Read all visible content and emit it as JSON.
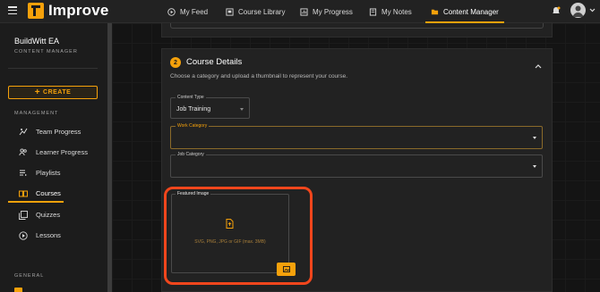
{
  "app": {
    "name": "Improve",
    "brand_color": "#f5a10b"
  },
  "nav": {
    "items": [
      {
        "label": "My Feed",
        "icon": "play-circle-icon"
      },
      {
        "label": "Course Library",
        "icon": "library-icon"
      },
      {
        "label": "My Progress",
        "icon": "chart-icon"
      },
      {
        "label": "My Notes",
        "icon": "notes-icon"
      },
      {
        "label": "Content Manager",
        "icon": "folder-icon",
        "active": true
      }
    ]
  },
  "sidebar": {
    "org_name": "BuildWitt EA",
    "role": "CONTENT MANAGER",
    "create_label": "CREATE",
    "management_label": "MANAGEMENT",
    "general_label": "GENERAL",
    "items": [
      {
        "label": "Team Progress",
        "icon": "team-progress-icon"
      },
      {
        "label": "Learner Progress",
        "icon": "learners-icon"
      },
      {
        "label": "Playlists",
        "icon": "playlist-icon"
      },
      {
        "label": "Courses",
        "icon": "courses-icon",
        "active": true
      },
      {
        "label": "Quizzes",
        "icon": "quizzes-icon"
      },
      {
        "label": "Lessons",
        "icon": "lessons-icon"
      }
    ]
  },
  "course_details": {
    "step": "2",
    "title": "Course Details",
    "description": "Choose a category and upload a thumbnail to represent your course.",
    "content_type": {
      "label": "Content Type",
      "value": "Job Training"
    },
    "work_category": {
      "label": "Work Category",
      "value": ""
    },
    "job_category": {
      "label": "Job Category",
      "value": ""
    },
    "featured_image": {
      "label": "Featured Image",
      "hint": "SVG, PNG, JPG or GIF (max. 3MB)"
    }
  },
  "annotation": {
    "highlight_color": "#f2461c"
  }
}
